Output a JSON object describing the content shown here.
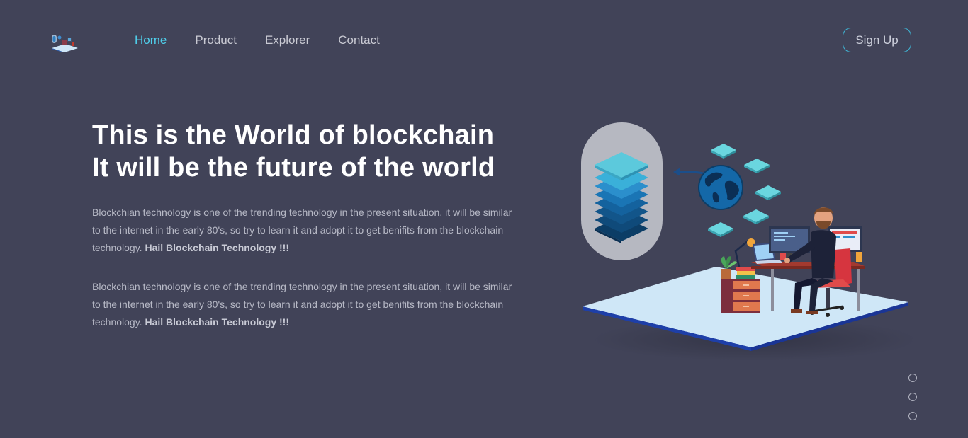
{
  "header": {
    "logo_icon": "blockchain-desk-logo-icon",
    "nav": [
      {
        "label": "Home",
        "active": true
      },
      {
        "label": "Product",
        "active": false
      },
      {
        "label": "Explorer",
        "active": false
      },
      {
        "label": "Contact",
        "active": false
      }
    ],
    "signup_label": "Sign Up"
  },
  "hero": {
    "title_line1": "This is the World of blockchain",
    "title_line2": "It will be the future of the world",
    "paragraphs": [
      {
        "text": "Blockchian technology is one of the trending technology in the present situation, it will be similar to the internet in the early 80's, so try to learn it and adopt it to get benifits from the blockchain technology. ",
        "bold": "Hail Blockchain Technology !!!"
      },
      {
        "text": "Blockchian technology is one of the trending technology in the present situation, it will be similar to the internet in the early 80's, so try to learn it and adopt it to get benifits from the blockchain technology. ",
        "bold": "Hail Blockchain Technology !!!"
      }
    ],
    "illustration_icon": "blockchain-workspace-illustration"
  },
  "slider": {
    "dot_count": 3
  },
  "colors": {
    "background": "#414358",
    "accent": "#4fd0ec",
    "title": "#ffffff",
    "body_text": "#b7b9c6"
  }
}
